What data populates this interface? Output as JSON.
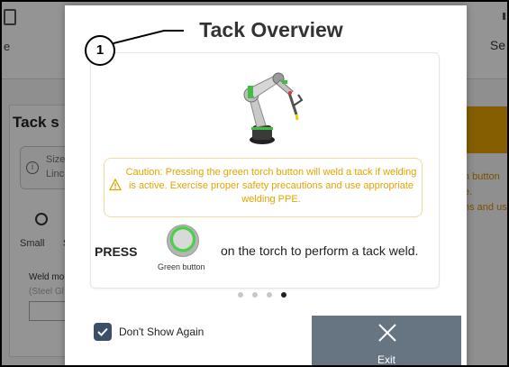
{
  "background": {
    "top_left_text": "e",
    "top_right_text": "Se",
    "panel_title": "Tack s",
    "info_line1": "Size",
    "info_line2": "Linc",
    "radio_label": "Small",
    "radio_label2": "S",
    "weld_mode": "Weld mo",
    "steel": "(Steel Gl",
    "right_line1": "n button",
    "right_line2": "e.",
    "right_line3": "ns and us"
  },
  "callout": {
    "number": "1"
  },
  "modal": {
    "title": "Tack Overview",
    "caution": "Caution: Pressing the green torch button will weld a tack if welding is active. Exercise proper safety precautions and use appropriate welding PPE.",
    "press_label": "PRESS",
    "green_button_label": "Green button",
    "instruction": "on the torch to perform a tack weld.",
    "pagination": {
      "total": 4,
      "active": 4
    },
    "dont_show_again": "Don't Show Again",
    "dont_show_checked": true,
    "exit_label": "Exit"
  },
  "colors": {
    "caution": "#e2a400",
    "exit_button": "#677482",
    "checkbox": "#3b4f66",
    "orange_accent": "#e3a300"
  }
}
